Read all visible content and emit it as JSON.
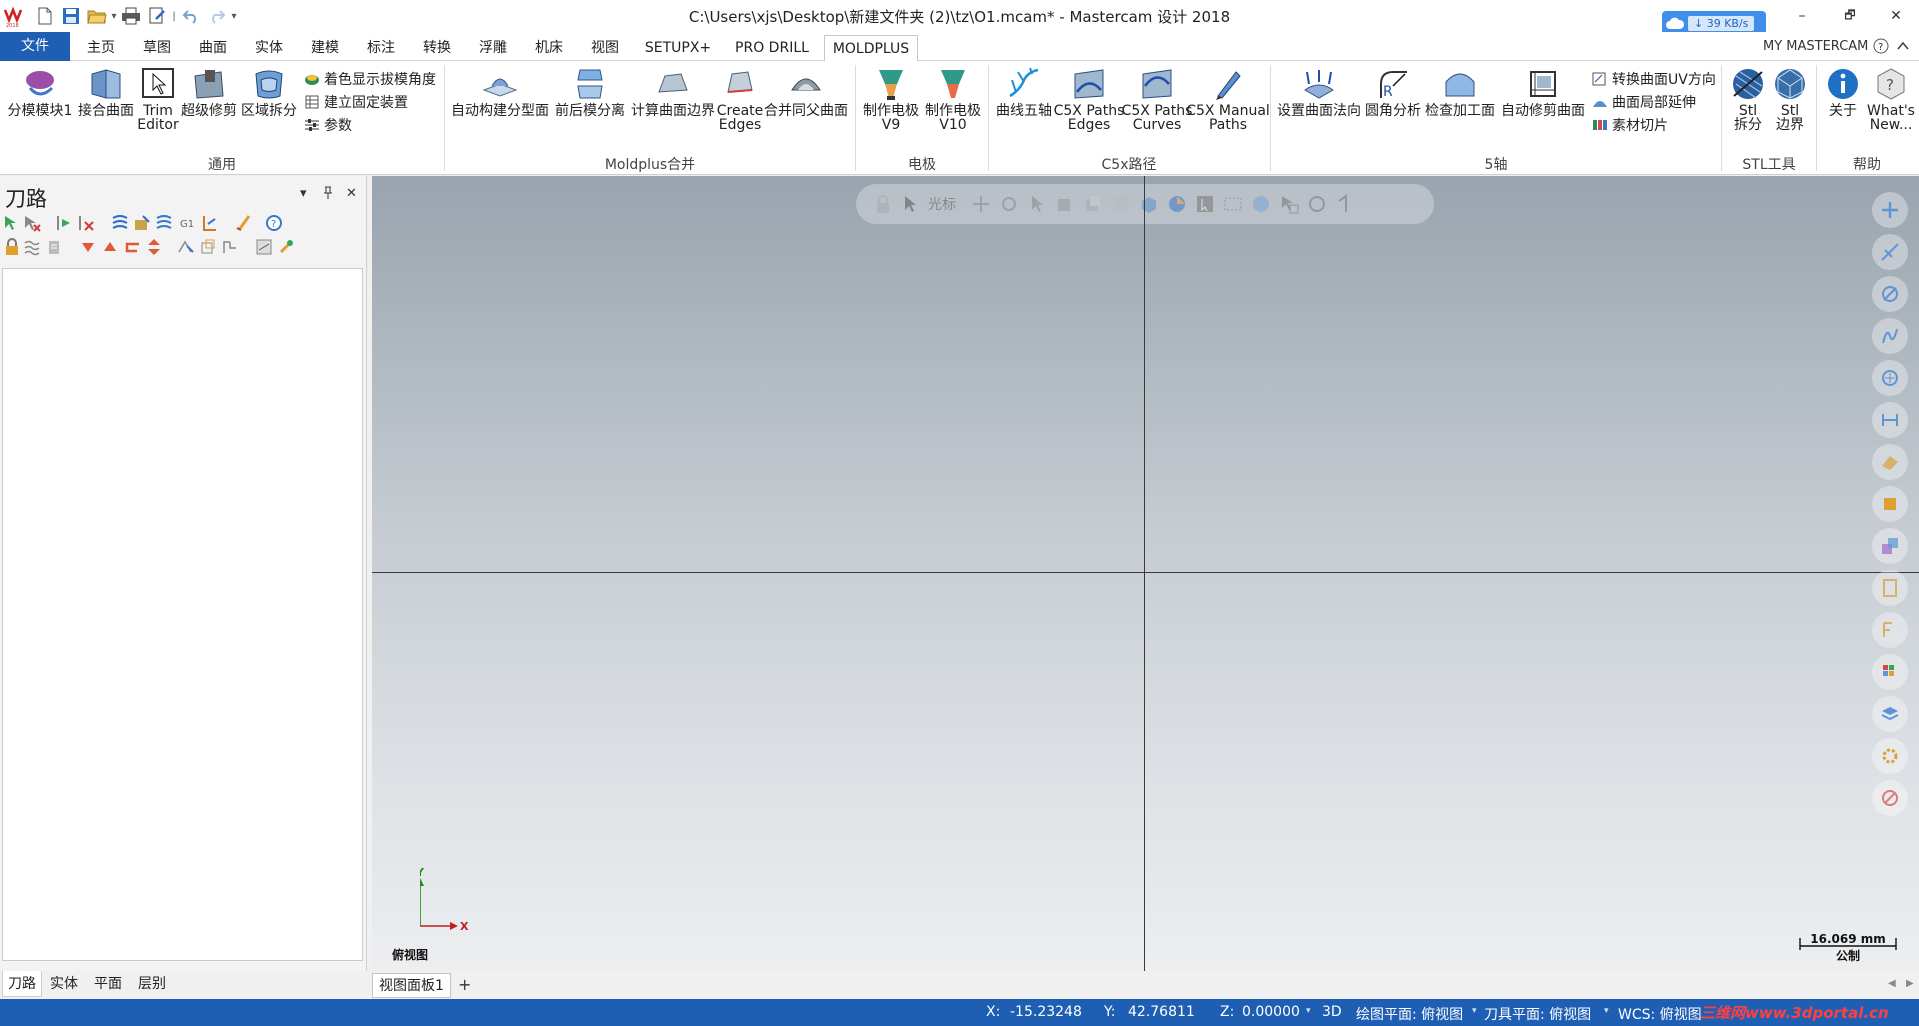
{
  "window": {
    "title": "C:\\Users\\xjs\\Desktop\\新建文件夹 (2)\\tz\\O1.mcam* - Mastercam 设计 2018",
    "net_speed": "39 KB/s",
    "minimize": "–",
    "restore": "🗗",
    "close": "✕"
  },
  "tabs": [
    {
      "label": "文件"
    },
    {
      "label": "主页"
    },
    {
      "label": "草图"
    },
    {
      "label": "曲面"
    },
    {
      "label": "实体"
    },
    {
      "label": "建模"
    },
    {
      "label": "标注"
    },
    {
      "label": "转换"
    },
    {
      "label": "浮雕"
    },
    {
      "label": "机床"
    },
    {
      "label": "视图"
    },
    {
      "label": "SETUPX+"
    },
    {
      "label": "PRO DRILL"
    },
    {
      "label": "MOLDPLUS"
    }
  ],
  "my_mastercam": "MY MASTERCAM",
  "ribbon": {
    "groups": {
      "general": "通用",
      "moldplus": "Moldplus合并",
      "electrode": "电极",
      "c5x": "C5x路径",
      "five_axis": "5轴",
      "stl": "STL工具",
      "help": "帮助"
    },
    "buttons": {
      "b1": "分模模块1",
      "b2": "接合曲面",
      "b3a": "Trim",
      "b3b": "Editor",
      "b4": "超级修剪",
      "b5": "区域拆分",
      "s1": "着色显示拔模角度",
      "s2": "建立固定装置",
      "s3": "参数",
      "b6": "自动构建分型面",
      "b7": "前后模分离",
      "b8": "计算曲面边界",
      "b9a": "Create",
      "b9b": "Edges",
      "b10": "合并同父曲面",
      "b11a": "制作电极",
      "b11b": "V9",
      "b12a": "制作电极",
      "b12b": "V10",
      "b13": "曲线五轴",
      "b14a": "C5X Paths",
      "b14b": "Edges",
      "b15a": "C5X Paths",
      "b15b": "Curves",
      "b16a": "C5X Manual",
      "b16b": "Paths",
      "b17": "设置曲面法向",
      "b18": "圆角分析",
      "b19": "检查加工面",
      "b20": "自动修剪曲面",
      "s4": "转换曲面UV方向",
      "s5": "曲面局部延伸",
      "s6": "素材切片",
      "b21a": "Stl",
      "b21b": "拆分",
      "b22a": "Stl",
      "b22b": "边界",
      "b23": "关于",
      "b24a": "What's",
      "b24b": "New..."
    }
  },
  "panel": {
    "title": "刀路",
    "tabs": [
      "刀路",
      "实体",
      "平面",
      "层别"
    ]
  },
  "viewport": {
    "toolbar_cursor": "光标",
    "view_name": "俯视图",
    "scale_value": "16.069 mm",
    "scale_unit": "公制",
    "sheet_tab": "视图面板1",
    "add_tab": "+",
    "gnomon_x": "X",
    "gnomon_y": "Y"
  },
  "status": {
    "x_label": "X:",
    "x_value": "-15.23248",
    "y_label": "Y:",
    "y_value": "42.76811",
    "z_label": "Z:",
    "z_value": "0.00000",
    "mode": "3D",
    "cplane": "绘图平面: 俯视图",
    "tplane": "刀具平面: 俯视图",
    "wcs": "WCS: 俯视图",
    "watermark": "三维网www.3dportal.cn"
  }
}
